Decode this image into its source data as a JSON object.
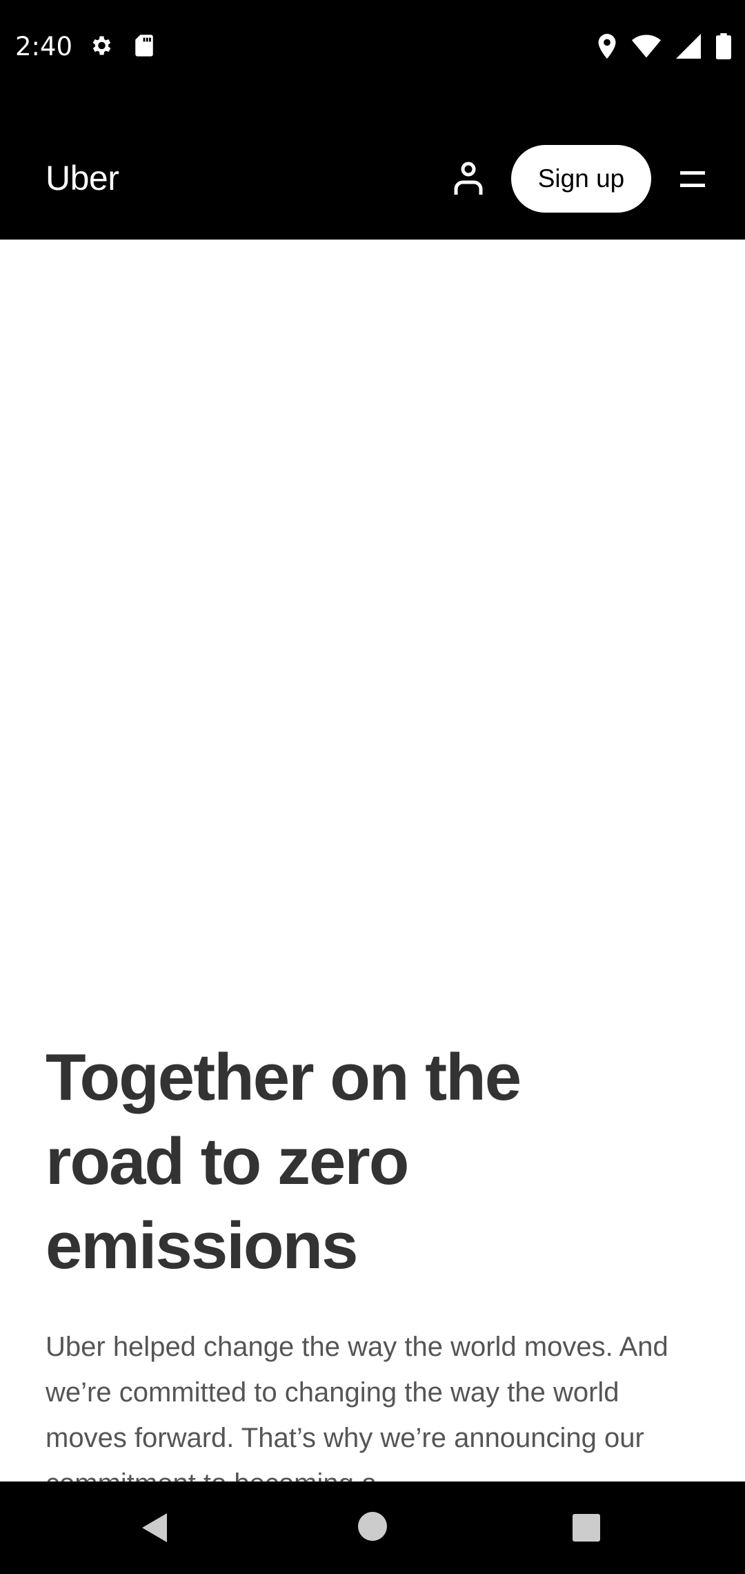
{
  "status_bar": {
    "time": "2:40",
    "left_icons": [
      "settings-icon",
      "sd-card-icon"
    ],
    "right_icons": [
      "location-icon",
      "wifi-icon",
      "signal-icon",
      "battery-icon"
    ]
  },
  "header": {
    "logo": "Uber",
    "signup_label": "Sign up",
    "login_icon": "person-icon",
    "menu_icon": "menu-icon"
  },
  "hero": {
    "title": "Together on the road to zero emissions",
    "body": "Uber helped change the way the world moves. And we’re committed to changing the way the world moves forward. That’s why we’re announcing our commitment to becoming a"
  },
  "nav_bar": {
    "icons": [
      "back-icon",
      "home-icon",
      "recents-icon"
    ]
  },
  "colors": {
    "header_bg": "#000000",
    "title_text": "#333333",
    "body_text": "#555555"
  }
}
